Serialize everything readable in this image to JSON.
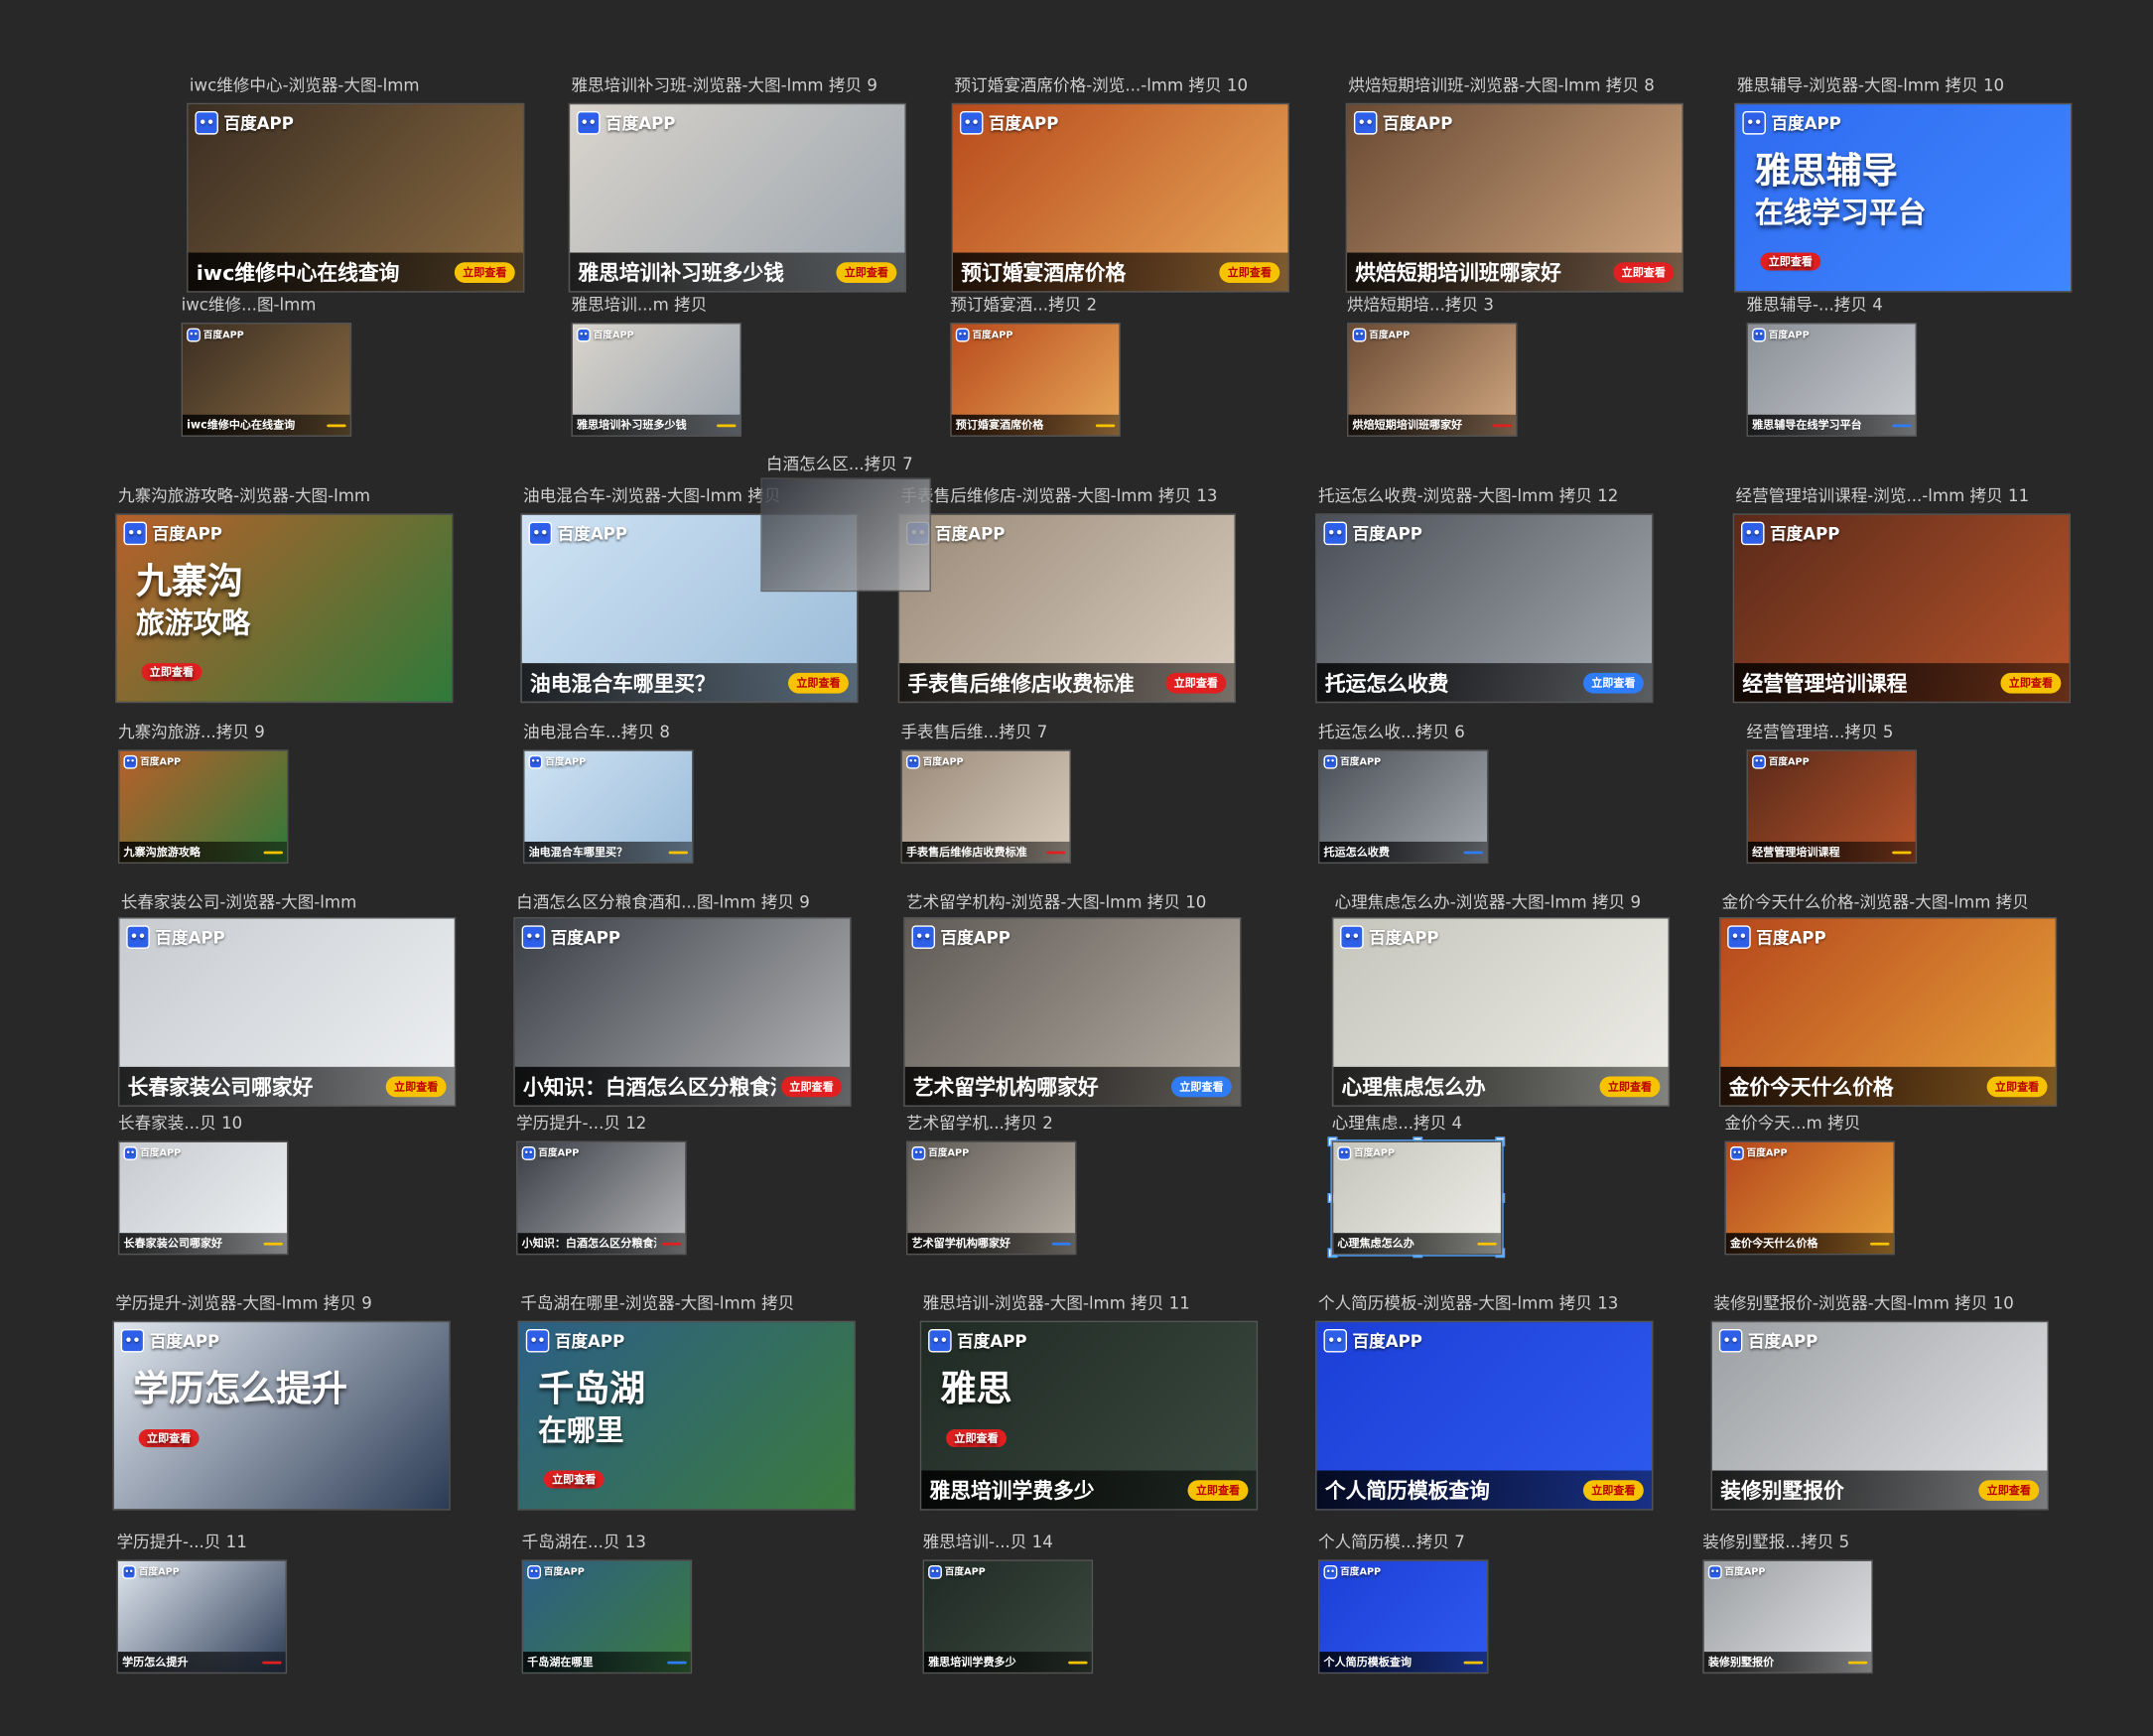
{
  "app": {
    "name": "Design artboard canvas"
  },
  "brand": {
    "logo_text": "百度APP",
    "logo_icon": "baidu-paw-icon",
    "accent": "#2e5fe8"
  },
  "rows": [
    {
      "large": [
        {
          "label": "iwc维修中心-浏览器-大图-lmm",
          "caption": "iwc维修中心在线查询",
          "button": "立即查看",
          "bg": [
            "#3b2e22",
            "#8b6b42"
          ]
        },
        {
          "label": "雅思培训补习班-浏览器-大图-lmm 拷贝 9",
          "caption": "雅思培训补习班多少钱",
          "button": "立即查看",
          "bg": [
            "#d9d4cc",
            "#9aa3ad"
          ]
        },
        {
          "label": "预订婚宴酒席价格-浏览...-lmm 拷贝 10",
          "caption": "预订婚宴酒席价格",
          "button": "立即查看",
          "bg": [
            "#b84a1c",
            "#e8a95a"
          ]
        },
        {
          "label": "烘焙短期培训班-浏览器-大图-lmm 拷贝 8",
          "caption": "烘焙短期培训班哪家好",
          "button": "立即查看",
          "bg": [
            "#6a4a33",
            "#d2a882"
          ]
        },
        {
          "label": "雅思辅导-浏览器-大图-lmm 拷贝 10",
          "caption": "",
          "button": "立即查看",
          "bg": [
            "#2f6bf0",
            "#3f86ff"
          ],
          "headline": "雅思辅导",
          "subline": "在线学习平台"
        }
      ],
      "small": [
        {
          "label": "iwc维修...图-lmm",
          "caption": "iwc维修中心在线查询",
          "bg": [
            "#3b2e22",
            "#8b6b42"
          ]
        },
        {
          "label": "雅思培训...m 拷贝",
          "caption": "雅思培训补习班多少钱",
          "bg": [
            "#d9d4cc",
            "#9aa3ad"
          ]
        },
        {
          "label": "预订婚宴酒...拷贝 2",
          "caption": "预订婚宴酒席价格",
          "bg": [
            "#b84a1c",
            "#e8a95a"
          ]
        },
        {
          "label": "烘焙短期培...拷贝 3",
          "caption": "烘焙短期培训班哪家好",
          "bg": [
            "#6a4a33",
            "#d2a882"
          ]
        },
        {
          "label": "雅思辅导-...拷贝 4",
          "caption": "雅思辅导在线学习平台",
          "bg": [
            "#8a8f96",
            "#c9ccd0"
          ]
        }
      ]
    },
    {
      "large": [
        {
          "label": "九寨沟旅游攻略-浏览器-大图-lmm",
          "caption": "",
          "button": "立即查看",
          "bg": [
            "#b8602a",
            "#2f7a3a"
          ],
          "headline": "九寨沟",
          "subline": "旅游攻略"
        },
        {
          "label": "油电混合车-浏览器-大图-lmm 拷贝",
          "caption": "油电混合车哪里买？",
          "button": "立即查看",
          "bg": [
            "#cfe3f4",
            "#9bbbd8"
          ]
        },
        {
          "label": "手表售后维修店-浏览器-大图-lmm 拷贝 13",
          "caption": "手表售后维修店收费标准",
          "button": "立即查看",
          "bg": [
            "#9a8a78",
            "#d9cdbf"
          ]
        },
        {
          "label": "托运怎么收费-浏览器-大图-lmm 拷贝 12",
          "caption": "托运怎么收费",
          "button": "立即查看",
          "bg": [
            "#4a4f57",
            "#a7acb3"
          ]
        },
        {
          "label": "经营管理培训课程-浏览...-lmm 拷贝 11",
          "caption": "经营管理培训课程",
          "button": "立即查看",
          "bg": [
            "#5a2a1a",
            "#b8542a"
          ]
        }
      ],
      "small": [
        {
          "label": "九寨沟旅游...拷贝 9",
          "caption": "九寨沟旅游攻略",
          "bg": [
            "#b8602a",
            "#2f7a3a"
          ]
        },
        {
          "label": "油电混合车...拷贝 8",
          "caption": "油电混合车哪里买？",
          "bg": [
            "#cfe3f4",
            "#9bbbd8"
          ]
        },
        {
          "label": "手表售后维...拷贝 7",
          "caption": "手表售后维修店收费标准",
          "bg": [
            "#9a8a78",
            "#d9cdbf"
          ]
        },
        {
          "label": "托运怎么收...拷贝 6",
          "caption": "托运怎么收费",
          "bg": [
            "#4a4f57",
            "#a7acb3"
          ]
        },
        {
          "label": "经营管理培...拷贝 5",
          "caption": "经营管理培训课程",
          "bg": [
            "#5a2a1a",
            "#b8542a"
          ]
        }
      ]
    },
    {
      "large": [
        {
          "label": "长春家装公司-浏览器-大图-lmm",
          "caption": "长春家装公司哪家好",
          "button": "立即查看",
          "bg": [
            "#c7cbd0",
            "#eef0f2"
          ]
        },
        {
          "label": "白酒怎么区分粮食酒和...图-lmm 拷贝 9",
          "caption": "小知识：白酒怎么区分粮食酒和勾兑酒？",
          "button": "立即查看",
          "bg": [
            "#3a3e45",
            "#b8b9bb"
          ]
        },
        {
          "label": "艺术留学机构-浏览器-大图-lmm 拷贝 10",
          "caption": "艺术留学机构哪家好",
          "button": "立即查看",
          "bg": [
            "#5f5a55",
            "#b7b0a6"
          ]
        },
        {
          "label": "心理焦虑怎么办-浏览器-大图-lmm 拷贝 9",
          "caption": "心理焦虑怎么办",
          "button": "立即查看",
          "bg": [
            "#c5c5bc",
            "#eeeee8"
          ]
        },
        {
          "label": "金价今天什么价格-浏览器-大图-lmm 拷贝",
          "caption": "金价今天什么价格",
          "button": "立即查看",
          "bg": [
            "#b5471c",
            "#e8a23a"
          ]
        }
      ],
      "small": [
        {
          "label": "长春家装...贝 10",
          "caption": "长春家装公司哪家好",
          "bg": [
            "#c7cbd0",
            "#eef0f2"
          ]
        },
        {
          "label": "学历提升-...贝 12",
          "caption": "小知识：白酒怎么区分粮食酒和勾兑酒？",
          "bg": [
            "#3a3e45",
            "#b8b9bb"
          ]
        },
        {
          "label": "艺术留学机...拷贝 2",
          "caption": "艺术留学机构哪家好",
          "bg": [
            "#5f5a55",
            "#b7b0a6"
          ]
        },
        {
          "label": "心理焦虑...拷贝 4",
          "caption": "心理焦虑怎么办",
          "bg": [
            "#c5c5bc",
            "#eeeee8"
          ]
        },
        {
          "label": "金价今天...m 拷贝",
          "caption": "金价今天什么价格",
          "bg": [
            "#b5471c",
            "#e8a23a"
          ]
        }
      ]
    },
    {
      "large": [
        {
          "label": "学历提升-浏览器-大图-lmm 拷贝 9",
          "caption": "",
          "button": "立即查看",
          "bg": [
            "#dfe6ee",
            "#2c3b55"
          ],
          "headline": "学历怎么提升",
          "subline": ""
        },
        {
          "label": "千岛湖在哪里-浏览器-大图-lmm 拷贝",
          "caption": "",
          "button": "立即查看",
          "bg": [
            "#2c5f86",
            "#3b7a3e"
          ],
          "headline": "千岛湖",
          "subline": "在哪里"
        },
        {
          "label": "雅思培训-浏览器-大图-lmm 拷贝 11",
          "caption": "雅思培训学费多少",
          "button": "立即查看",
          "bg": [
            "#1f2a24",
            "#3b4a40"
          ],
          "headline": "雅思",
          "subline": ""
        },
        {
          "label": "个人简历模板-浏览器-大图-lmm 拷贝 13",
          "caption": "个人简历模板查询",
          "button": "立即查看",
          "bg": [
            "#1c3fd6",
            "#2e5af0"
          ]
        },
        {
          "label": "装修别墅报价-浏览器-大图-lmm 拷贝 10",
          "caption": "装修别墅报价",
          "button": "立即查看",
          "bg": [
            "#9c9fa3",
            "#e3e4e6"
          ]
        }
      ],
      "small": [
        {
          "label": "学历提升-...贝 11",
          "caption": "学历怎么提升",
          "bg": [
            "#dfe6ee",
            "#2c3b55"
          ]
        },
        {
          "label": "千岛湖在...贝 13",
          "caption": "千岛湖在哪里",
          "bg": [
            "#2c5f86",
            "#3b7a3e"
          ]
        },
        {
          "label": "雅思培训-...贝 14",
          "caption": "雅思培训学费多少",
          "bg": [
            "#1f2a24",
            "#3b4a40"
          ]
        },
        {
          "label": "个人简历模...拷贝 7",
          "caption": "个人简历模板查询",
          "bg": [
            "#1c3fd6",
            "#2e5af0"
          ]
        },
        {
          "label": "装修别墅报...拷贝 5",
          "caption": "装修别墅报价",
          "bg": [
            "#9c9fa3",
            "#e3e4e6"
          ]
        }
      ]
    }
  ],
  "floating": {
    "label": "白酒怎么区...拷贝 7"
  }
}
